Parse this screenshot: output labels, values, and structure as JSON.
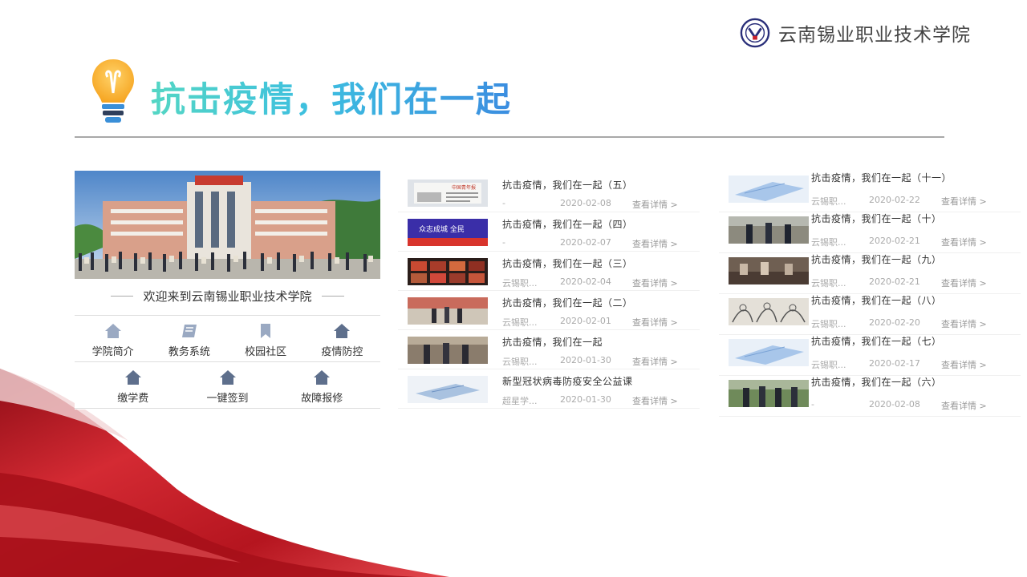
{
  "header": {
    "school_name": "云南锡业职业技术学院",
    "title": "抗击疫情，我们在一起"
  },
  "portal": {
    "welcome": "欢迎来到云南锡业职业技术学院",
    "row1": [
      {
        "label": "学院简介",
        "icon": "home-icon"
      },
      {
        "label": "教务系统",
        "icon": "book-icon"
      },
      {
        "label": "校园社区",
        "icon": "bookmark-icon"
      },
      {
        "label": "疫情防控",
        "icon": "home-icon"
      }
    ],
    "row2": [
      {
        "label": "缴学费",
        "icon": "home-icon"
      },
      {
        "label": "一键签到",
        "icon": "home-icon"
      },
      {
        "label": "故障报修",
        "icon": "home-icon"
      }
    ]
  },
  "news_left": [
    {
      "title": "抗击疫情，我们在一起（五）",
      "source": "-",
      "date": "2020-02-08",
      "more": "查看详情 >"
    },
    {
      "title": "抗击疫情，我们在一起（四）",
      "source": "-",
      "date": "2020-02-07",
      "more": "查看详情 >"
    },
    {
      "title": "抗击疫情，我们在一起（三）",
      "source": "云锡职...",
      "date": "2020-02-04",
      "more": "查看详情 >"
    },
    {
      "title": "抗击疫情，我们在一起（二）",
      "source": "云锡职...",
      "date": "2020-02-01",
      "more": "查看详情 >"
    },
    {
      "title": "抗击疫情，我们在一起",
      "source": "云锡职...",
      "date": "2020-01-30",
      "more": "查看详情 >"
    },
    {
      "title": "新型冠状病毒防疫安全公益课",
      "source": "超星学...",
      "date": "2020-01-30",
      "more": "查看详情 >"
    }
  ],
  "news_right": [
    {
      "title": "抗击疫情，我们在一起（十一）",
      "source": "云锡职...",
      "date": "2020-02-22",
      "more": "查看详情 >"
    },
    {
      "title": "抗击疫情，我们在一起（十）",
      "source": "云锡职...",
      "date": "2020-02-21",
      "more": "查看详情 >"
    },
    {
      "title": "抗击疫情，我们在一起（九）",
      "source": "云锡职...",
      "date": "2020-02-21",
      "more": "查看详情 >"
    },
    {
      "title": "抗击疫情，我们在一起（八）",
      "source": "云锡职...",
      "date": "2020-02-20",
      "more": "查看详情 >"
    },
    {
      "title": "抗击疫情，我们在一起（七）",
      "source": "云锡职...",
      "date": "2020-02-17",
      "more": "查看详情 >"
    },
    {
      "title": "抗击疫情，我们在一起（六）",
      "source": "-",
      "date": "2020-02-08",
      "more": "查看详情 >"
    }
  ],
  "thumb_text": {
    "left_1": "中国青年报",
    "left_2": "众志成城 全民"
  },
  "colors": {
    "title_gradient_start": "#54d6c4",
    "title_gradient_end": "#3b8de0",
    "icon_slate": "#5e6f8c",
    "icon_light": "#9aa9c2",
    "ribbon_red": "#c8202a"
  }
}
